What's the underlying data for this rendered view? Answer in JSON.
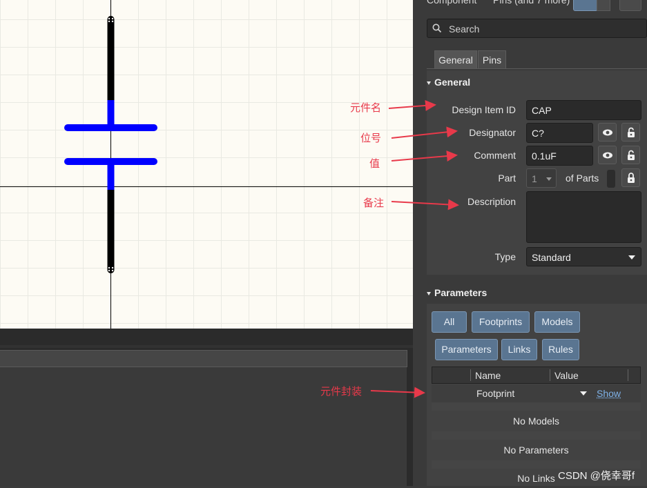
{
  "header": {
    "left_label": "Component",
    "center_label": "Pins (and 7 more)"
  },
  "search": {
    "placeholder": "Search"
  },
  "tabs": [
    {
      "label": "General"
    },
    {
      "label": "Pins"
    }
  ],
  "general": {
    "title": "General",
    "design_item_id": {
      "label": "Design Item ID",
      "value": "CAP"
    },
    "designator": {
      "label": "Designator",
      "value": "C?"
    },
    "comment": {
      "label": "Comment",
      "value": "0.1uF"
    },
    "part": {
      "label": "Part",
      "value": "1",
      "of_parts": "of Parts"
    },
    "description": {
      "label": "Description",
      "value": ""
    },
    "type": {
      "label": "Type",
      "value": "Standard"
    }
  },
  "parameters": {
    "title": "Parameters",
    "filter_buttons_row1": [
      "All",
      "Footprints",
      "Models"
    ],
    "filter_buttons_row2": [
      "Parameters",
      "Links",
      "Rules"
    ],
    "columns": [
      "Name",
      "Value"
    ],
    "rows": [
      {
        "name": "Footprint",
        "action": "Show"
      }
    ],
    "empty_messages": [
      "No Models",
      "No Parameters",
      "No Links"
    ]
  },
  "annotations": [
    "元件名",
    "位号",
    "值",
    "备注",
    "元件封装"
  ],
  "watermark": "CSDN @侥幸哥f",
  "colors": {
    "annotation": "#e8394a",
    "accent_button": "#5a7591",
    "schematic_pin": "#0000ff",
    "schematic_body": "#000000"
  }
}
